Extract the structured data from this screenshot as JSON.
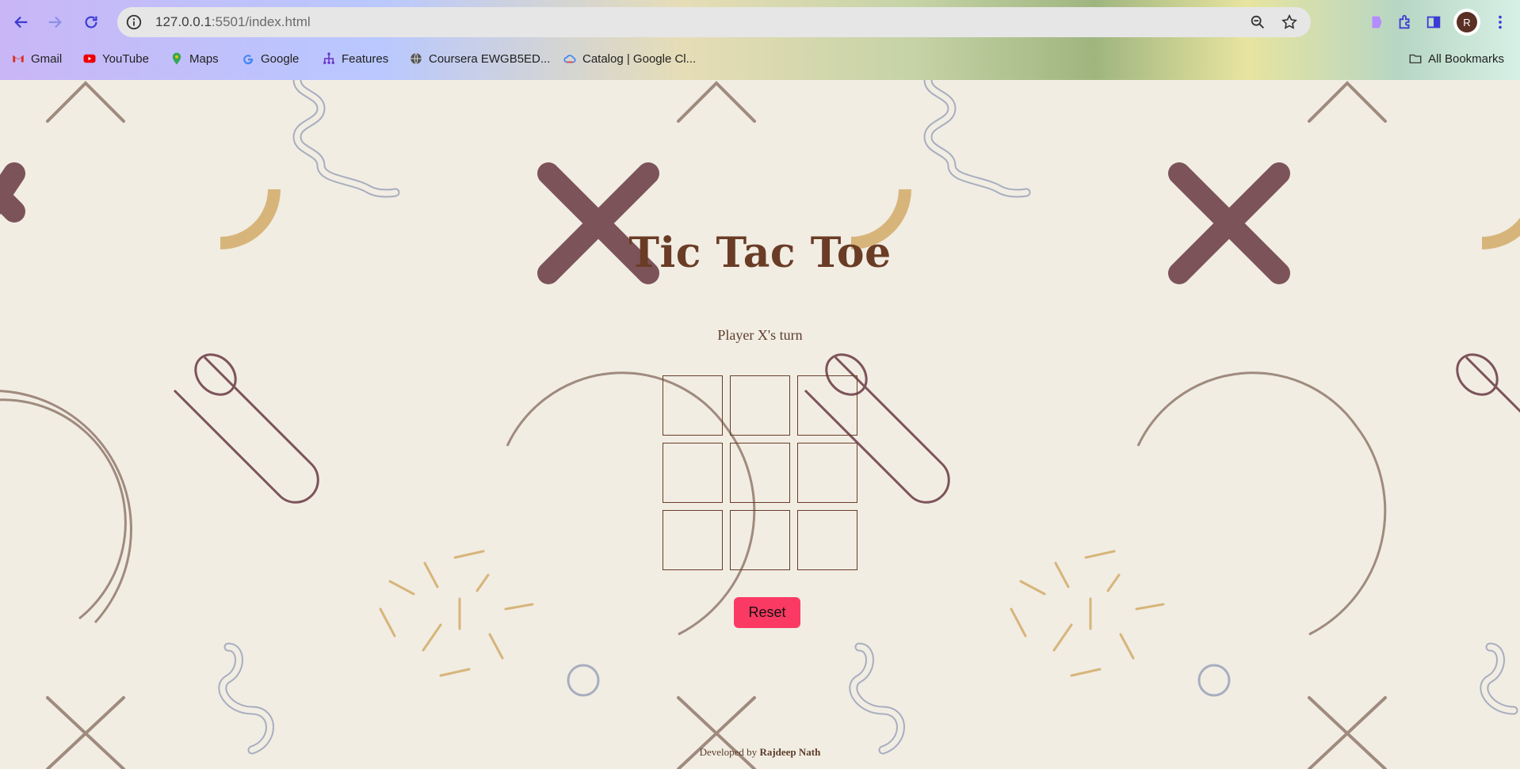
{
  "browser": {
    "url_host": "127.0.0.1",
    "url_path": ":5501/index.html",
    "avatar_letter": "R",
    "bookmarks": [
      {
        "label": "Gmail",
        "icon": "gmail-icon"
      },
      {
        "label": "YouTube",
        "icon": "youtube-icon"
      },
      {
        "label": "Maps",
        "icon": "maps-icon"
      },
      {
        "label": "Google",
        "icon": "google-icon"
      },
      {
        "label": "Features",
        "icon": "sitemap-icon"
      },
      {
        "label": "Coursera EWGB5ED...",
        "icon": "globe-icon"
      },
      {
        "label": "Catalog | Google Cl...",
        "icon": "google-cloud-icon"
      }
    ],
    "all_bookmarks_label": "All Bookmarks"
  },
  "game": {
    "title": "Tic Tac Toe",
    "status": "Player X's turn",
    "cells": [
      "",
      "",
      "",
      "",
      "",
      "",
      "",
      "",
      ""
    ],
    "reset_label": "Reset"
  },
  "footer": {
    "prefix": "Developed by",
    "author": "Rajdeep Nath"
  },
  "colors": {
    "background": "#f1ede3",
    "text_brown": "#6a3c26",
    "reset_button": "#fb3a63"
  }
}
